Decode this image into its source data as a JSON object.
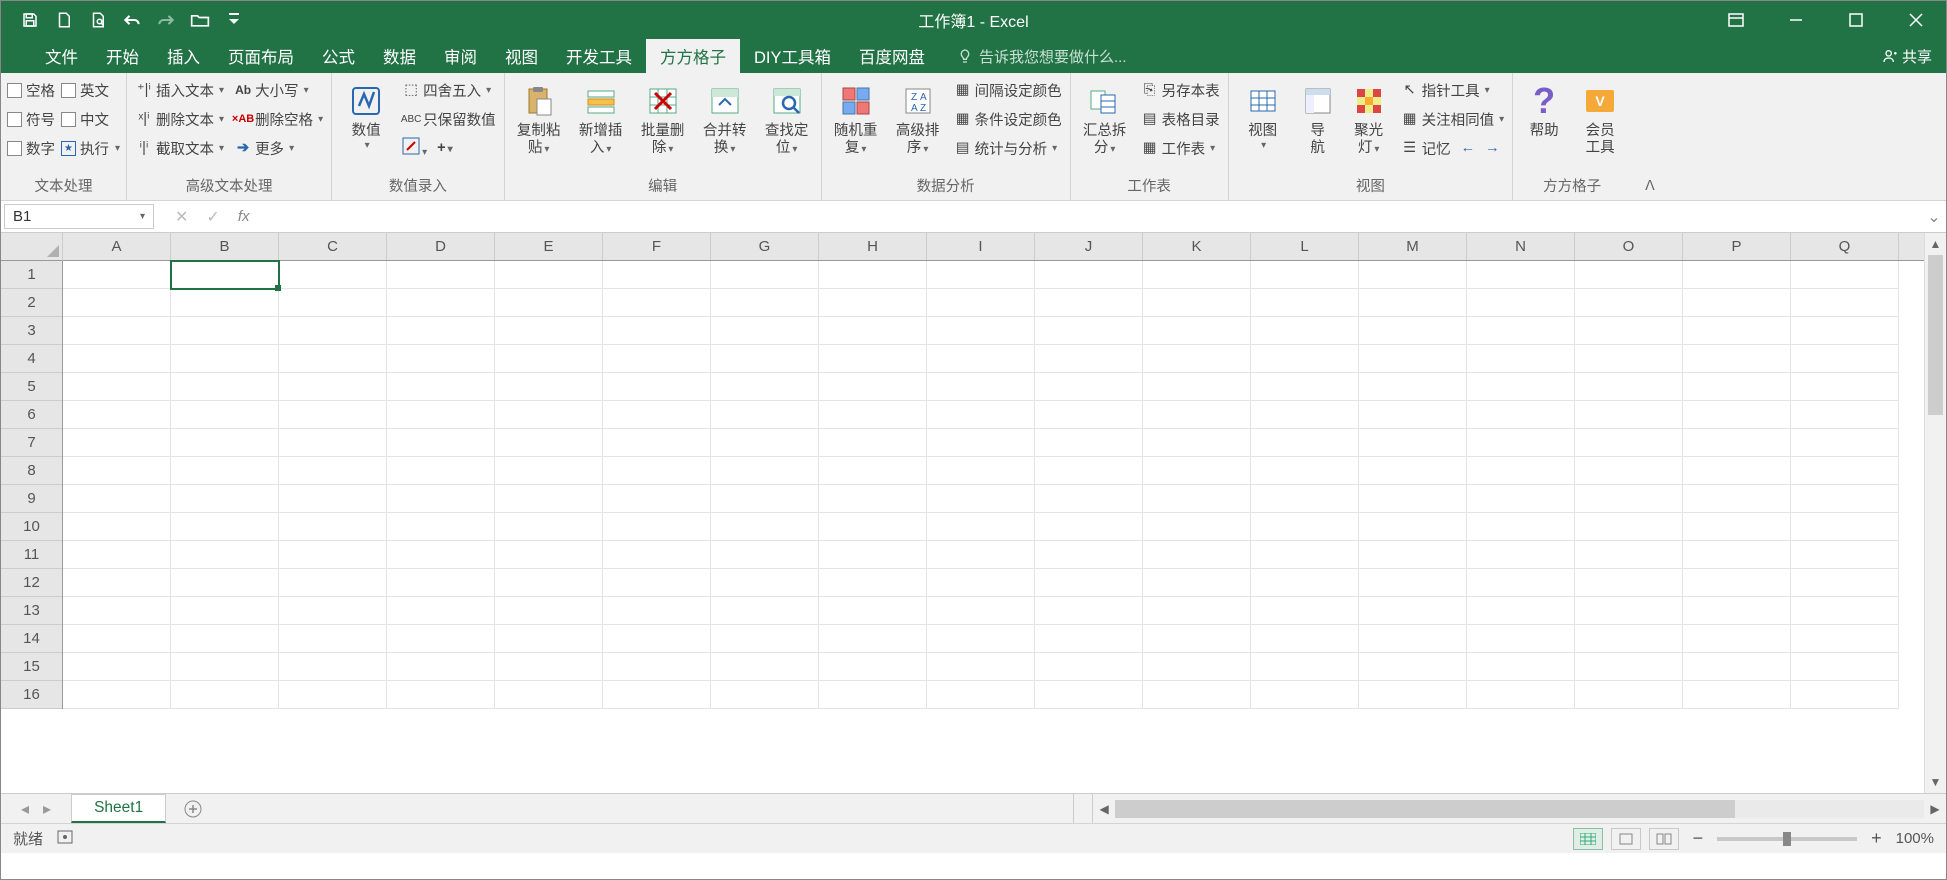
{
  "title": "工作簿1 - Excel",
  "tabs": [
    "文件",
    "开始",
    "插入",
    "页面布局",
    "公式",
    "数据",
    "审阅",
    "视图",
    "开发工具",
    "方方格子",
    "DIY工具箱",
    "百度网盘"
  ],
  "active_tab": "方方格子",
  "tell_me": "告诉我您想要做什么...",
  "share": "共享",
  "name_box": "B1",
  "ribbon": {
    "g1": {
      "label": "文本处理",
      "chk": [
        "空格",
        "英文",
        "符号",
        "中文",
        "数字"
      ],
      "execute": "执行"
    },
    "g2": {
      "label": "高级文本处理",
      "insert_text": "插入文本",
      "delete_text": "删除文本",
      "extract_text": "截取文本",
      "case": "大小写",
      "delete_space": "删除空格",
      "more": "更多"
    },
    "g3": {
      "label": "数值录入",
      "numeric": "数值",
      "round": "四舍五入",
      "keep_num": "只保留数值"
    },
    "g4": {
      "label": "编辑",
      "copy_paste_l1": "复制粘",
      "copy_paste_l2": "贴",
      "insert_new_l1": "新增插",
      "insert_new_l2": "入",
      "batch_del_l1": "批量删",
      "batch_del_l2": "除",
      "merge_conv_l1": "合并转",
      "merge_conv_l2": "换",
      "find_loc_l1": "查找定",
      "find_loc_l2": "位"
    },
    "g5": {
      "label": "数据分析",
      "random_l1": "随机重",
      "random_l2": "复",
      "adv_sort_l1": "高级排",
      "adv_sort_l2": "序",
      "interval_color": "间隔设定颜色",
      "cond_color": "条件设定颜色",
      "stats": "统计与分析"
    },
    "g6": {
      "label": "工作表",
      "pivot_l1": "汇总拆",
      "pivot_l2": "分",
      "save_as": "另存本表",
      "toc": "表格目录",
      "worksheet": "工作表"
    },
    "g7": {
      "label": "视图",
      "view": "视图",
      "navigate_l1": "导",
      "navigate_l2": "航",
      "spotlight_l1": "聚光",
      "spotlight_l2": "灯",
      "pointer_tool": "指针工具",
      "watch_same": "关注相同值",
      "memory": "记忆"
    },
    "g8": {
      "label": "方方格子",
      "help": "帮助",
      "member_l1": "会员",
      "member_l2": "工具"
    }
  },
  "columns": [
    "A",
    "B",
    "C",
    "D",
    "E",
    "F",
    "G",
    "H",
    "I",
    "J",
    "K",
    "L",
    "M",
    "N",
    "O",
    "P",
    "Q"
  ],
  "rows": [
    1,
    2,
    3,
    4,
    5,
    6,
    7,
    8,
    9,
    10,
    11,
    12,
    13,
    14,
    15,
    16
  ],
  "selected_cell": {
    "col": 1,
    "row": 0
  },
  "sheet_tab": "Sheet1",
  "status": {
    "ready": "就绪",
    "zoom": "100%"
  }
}
